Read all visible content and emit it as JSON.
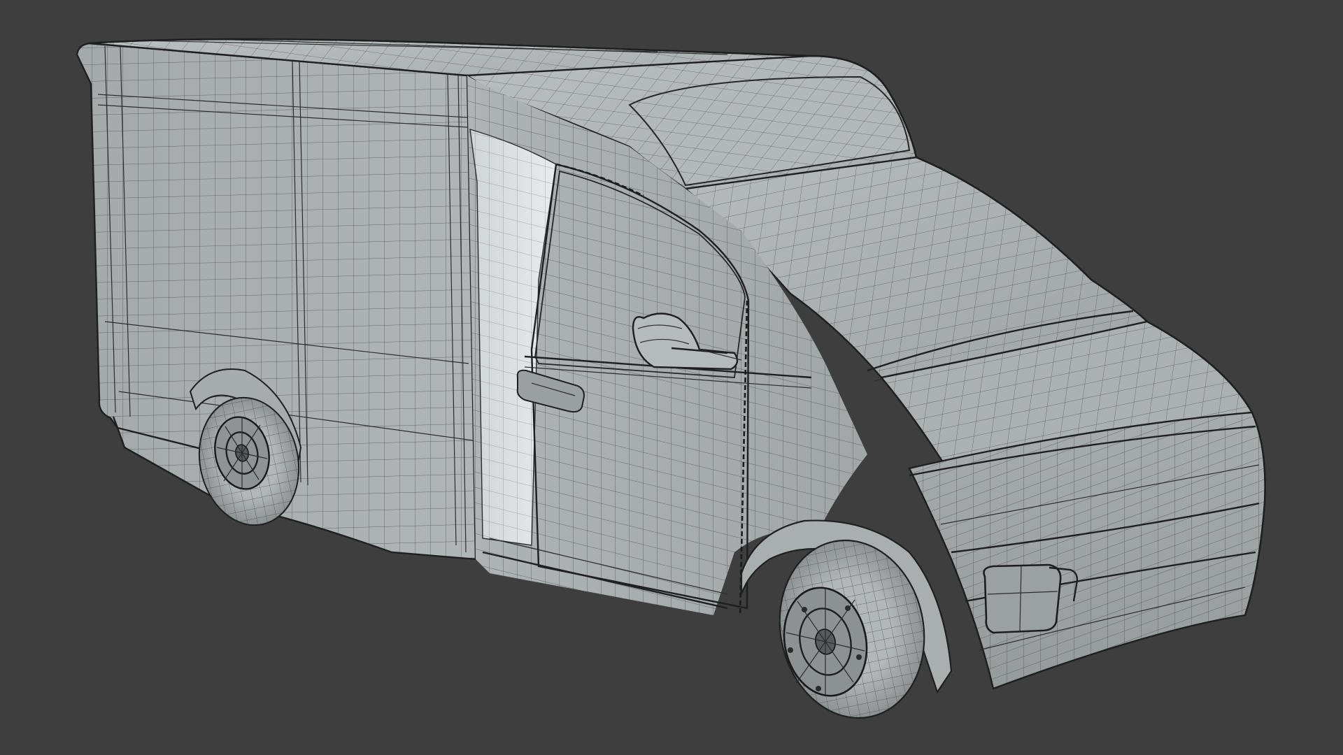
{
  "viewport": {
    "subject": "van-wireframe-model",
    "display_mode": "solid-with-wireframe",
    "background_color": "#3e3e3e",
    "surface_color": "#a8adad",
    "wire_color": "#2b2d2d"
  }
}
